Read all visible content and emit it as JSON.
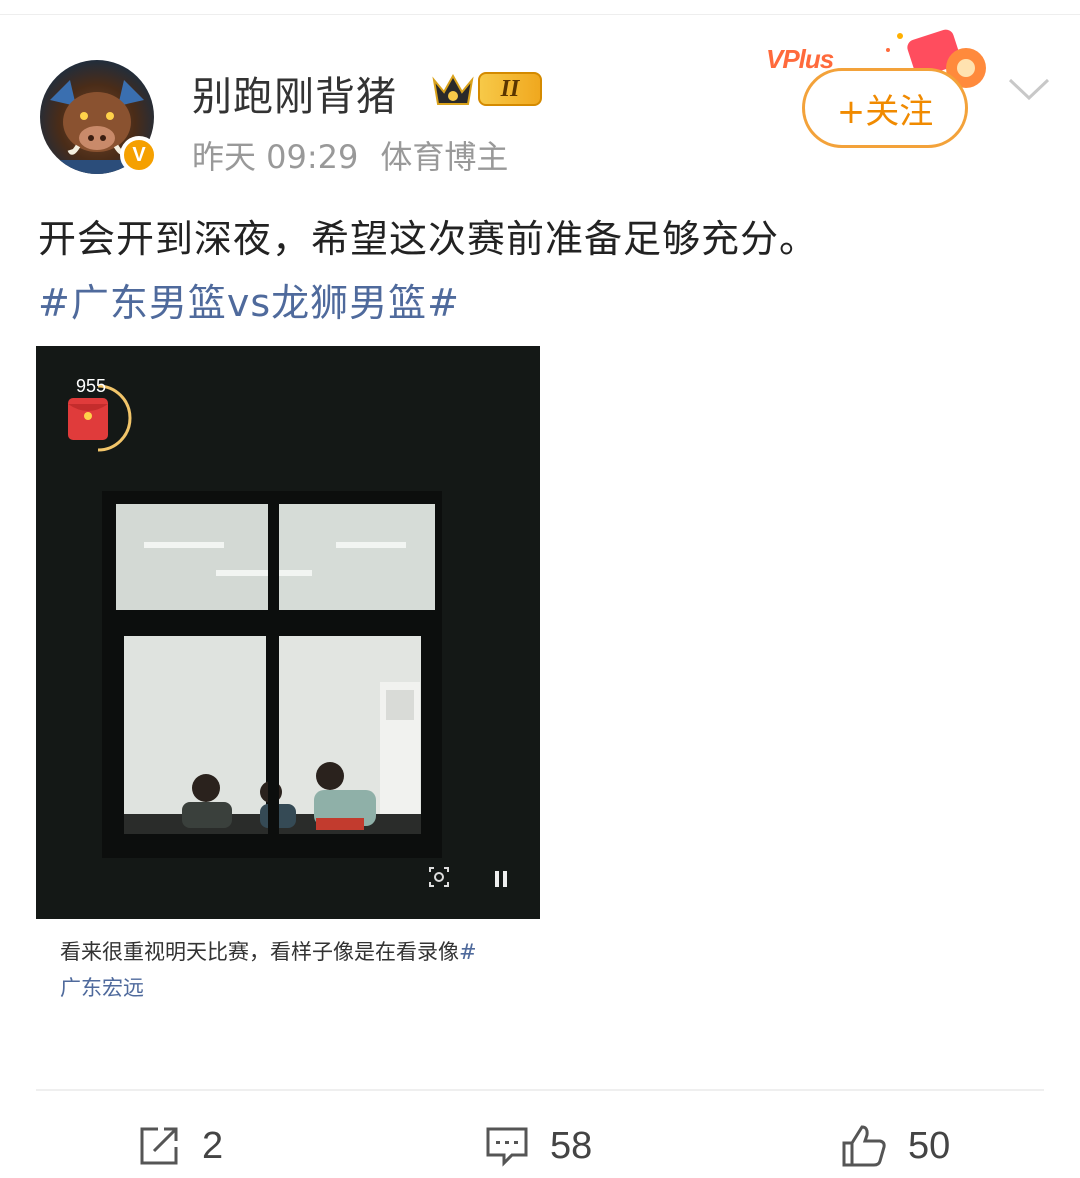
{
  "post": {
    "username": "别跑刚背猪",
    "level": "II",
    "time": "昨天 09:29",
    "category": "体育博主",
    "verified_badge": "V",
    "vplus_label": "VPlus",
    "follow_label": "+关注",
    "text": "开会开到深夜，希望这次赛前准备足够充分。",
    "hashtag": "#广东男篮vs龙狮男篮#"
  },
  "media": {
    "red_packet_count": "955",
    "caption_line1": "看来很重视明天比赛，看样子像是在看录像",
    "caption_tag_start": "#",
    "caption_line2": "广东宏远"
  },
  "actions": {
    "repost_count": "2",
    "comment_count": "58",
    "like_count": "50"
  },
  "colors": {
    "accent_orange": "#f08a00",
    "link_blue": "#4f6a9c",
    "verified": "#f5a000"
  },
  "icons": [
    "boar-avatar",
    "verified-icon",
    "crown-icon",
    "chevron-down-icon",
    "red-packet-icon",
    "zoom-icon",
    "pause-icon",
    "repost-icon",
    "comment-icon",
    "like-icon"
  ]
}
